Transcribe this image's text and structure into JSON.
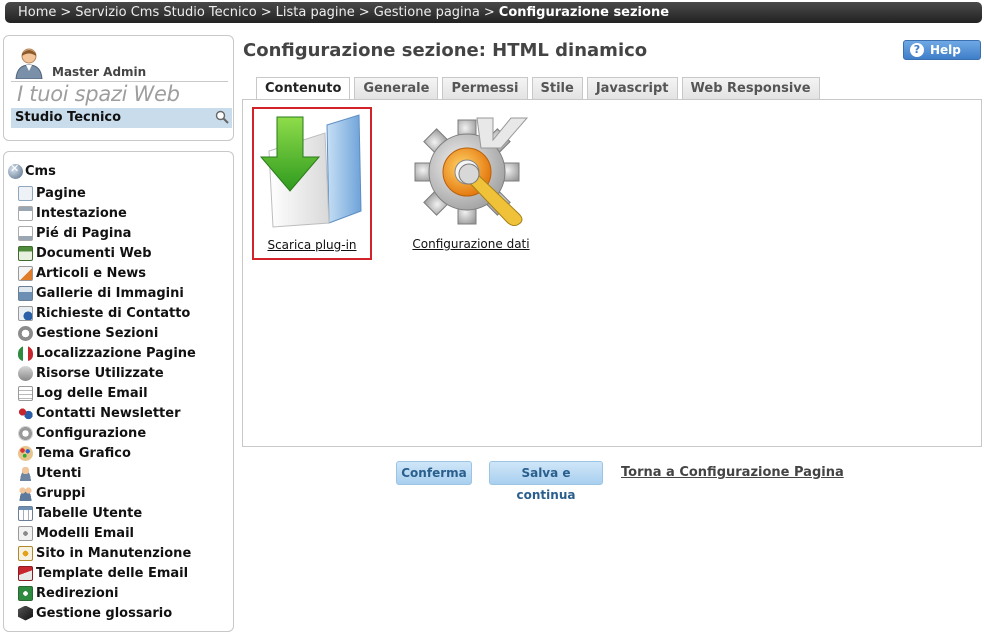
{
  "breadcrumb": {
    "items": [
      "Home",
      "Servizio Cms Studio Tecnico",
      "Lista pagine",
      "Gestione pagina"
    ],
    "current": "Configurazione sezione",
    "separator": ">"
  },
  "user": {
    "name": "Master Admin",
    "spaces_title": "I tuoi spazi Web",
    "selected_space": "Studio Tecnico"
  },
  "nav": {
    "root": "Cms",
    "items": [
      {
        "label": "Pagine",
        "icon": "page-icon"
      },
      {
        "label": "Intestazione",
        "icon": "header-icon"
      },
      {
        "label": "Pié di Pagina",
        "icon": "footer-icon"
      },
      {
        "label": "Documenti Web",
        "icon": "documents-icon"
      },
      {
        "label": "Articoli e News",
        "icon": "news-icon"
      },
      {
        "label": "Gallerie di Immagini",
        "icon": "gallery-icon"
      },
      {
        "label": "Richieste di Contatto",
        "icon": "contact-request-icon"
      },
      {
        "label": "Gestione Sezioni",
        "icon": "sections-icon"
      },
      {
        "label": "Localizzazione Pagine",
        "icon": "localization-icon"
      },
      {
        "label": "Risorse Utilizzate",
        "icon": "resources-icon"
      },
      {
        "label": "Log delle Email",
        "icon": "email-log-icon"
      },
      {
        "label": "Contatti Newsletter",
        "icon": "newsletter-icon"
      },
      {
        "label": "Configurazione",
        "icon": "gear-icon"
      },
      {
        "label": "Tema Grafico",
        "icon": "palette-icon"
      },
      {
        "label": "Utenti",
        "icon": "user-icon"
      },
      {
        "label": "Gruppi",
        "icon": "group-icon"
      },
      {
        "label": "Tabelle Utente",
        "icon": "table-icon"
      },
      {
        "label": "Modelli Email",
        "icon": "email-template-icon"
      },
      {
        "label": "Sito in Manutenzione",
        "icon": "maintenance-icon"
      },
      {
        "label": "Template delle Email",
        "icon": "mail-icon"
      },
      {
        "label": "Redirezioni",
        "icon": "redirect-icon"
      },
      {
        "label": "Gestione glossario",
        "icon": "glossary-icon"
      }
    ]
  },
  "main": {
    "title": "Configurazione sezione: HTML dinamico",
    "help_label": "Help",
    "tabs": [
      {
        "label": "Contenuto",
        "active": true
      },
      {
        "label": "Generale",
        "active": false
      },
      {
        "label": "Permessi",
        "active": false
      },
      {
        "label": "Stile",
        "active": false
      },
      {
        "label": "Javascript",
        "active": false
      },
      {
        "label": "Web Responsive",
        "active": false
      }
    ],
    "tiles": [
      {
        "label": "Scarica plug-in",
        "icon": "download-folder-icon"
      },
      {
        "label": "Configurazione dati",
        "icon": "config-tools-icon"
      }
    ]
  },
  "actions": {
    "confirm_label": "Conferma",
    "save_continue_label": "Salva e continua",
    "back_label": "Torna a Configurazione Pagina"
  },
  "colors": {
    "accent": "#c9dcec",
    "highlight_border": "#d2232a",
    "button_bg": "#a9d0ef",
    "help_button": "#3f7ec9"
  }
}
